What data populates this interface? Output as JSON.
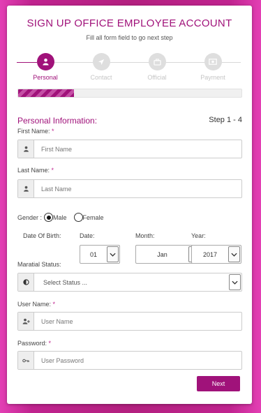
{
  "header": {
    "title": "SIGN UP OFFICE EMPLOYEE ACCOUNT",
    "subtitle": "Fill all form field to go next step"
  },
  "steps": [
    {
      "label": "Personal",
      "icon": "person-icon",
      "active": true
    },
    {
      "label": "Contact",
      "icon": "location-arrow-icon",
      "active": false
    },
    {
      "label": "Official",
      "icon": "briefcase-icon",
      "active": false
    },
    {
      "label": "Payment",
      "icon": "money-icon",
      "active": false
    }
  ],
  "progress": {
    "fraction": 0.25
  },
  "section": {
    "title": "Personal Information:",
    "step": "Step 1 - 4"
  },
  "fields": {
    "first_name": {
      "label": "First Name:",
      "required": "*",
      "placeholder": "First Name"
    },
    "last_name": {
      "label": "Last Name:",
      "required": "*",
      "placeholder": "Last Name"
    },
    "gender": {
      "label": "Gender :",
      "options": [
        "Male",
        "Female"
      ],
      "selected": "Male"
    },
    "dob": {
      "label": "Date Of Birth:",
      "date_label": "Date:",
      "date_value": "01",
      "month_label": "Month:",
      "month_value": "Jan",
      "year_label": "Year:",
      "year_value": "2017"
    },
    "marital_status": {
      "label": "Maratial Status:",
      "value": "Select Status ..."
    },
    "user_name": {
      "label": "User Name:",
      "required": "*",
      "placeholder": "User Name"
    },
    "password": {
      "label": "Password:",
      "required": "*",
      "placeholder": "User Password"
    }
  },
  "actions": {
    "next_label": "Next"
  },
  "colors": {
    "accent": "#a0127a",
    "background": "#b3207f"
  }
}
